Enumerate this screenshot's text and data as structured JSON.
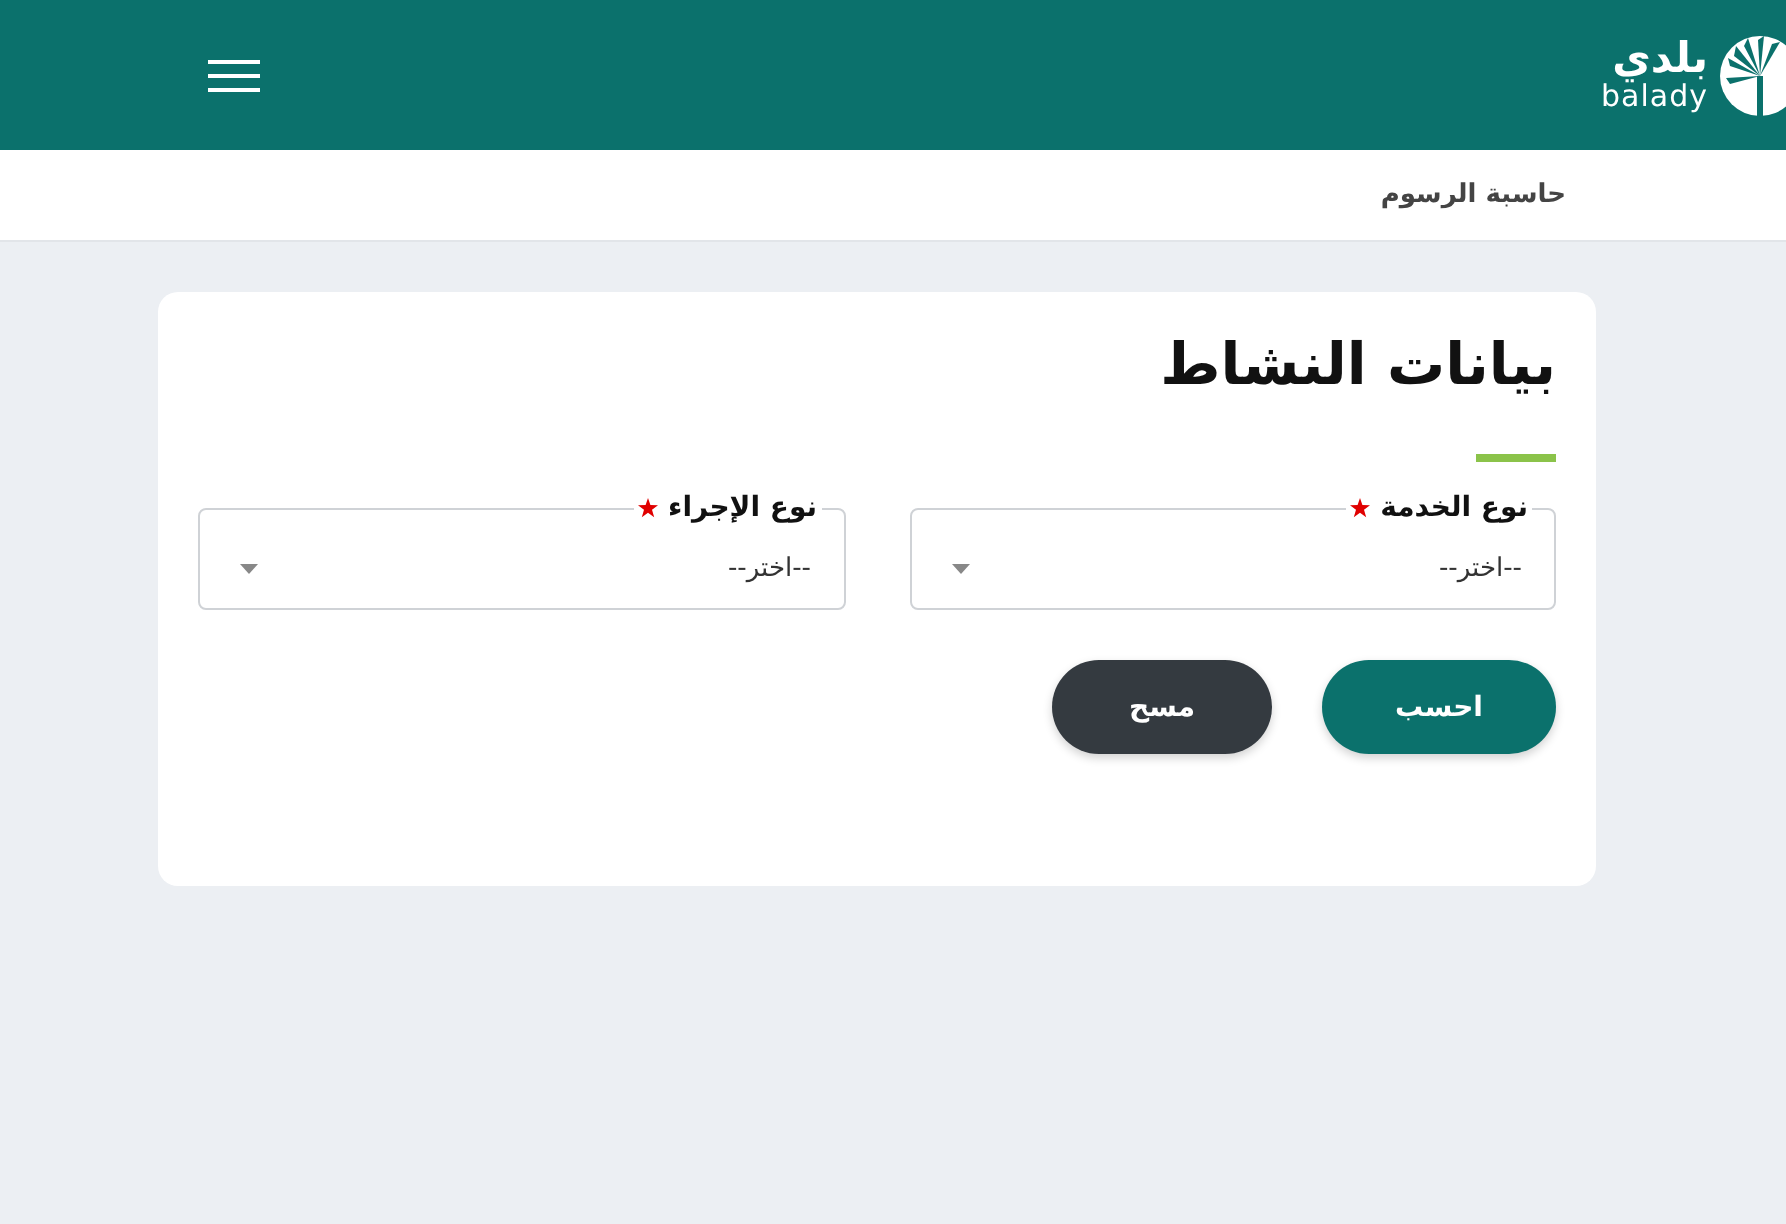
{
  "header": {
    "logo": {
      "arabic": "بلدي",
      "latin": "balady"
    }
  },
  "breadcrumb": {
    "current": "حاسبة الرسوم"
  },
  "card": {
    "title": "بيانات النشاط",
    "fields": [
      {
        "label": "نوع الخدمة",
        "required": true,
        "placeholder": "--اختر--"
      },
      {
        "label": "نوع الإجراء",
        "required": true,
        "placeholder": "--اختر--"
      }
    ],
    "buttons": [
      {
        "label": "احسب",
        "kind": "primary"
      },
      {
        "label": "مسح",
        "kind": "secondary"
      }
    ]
  }
}
